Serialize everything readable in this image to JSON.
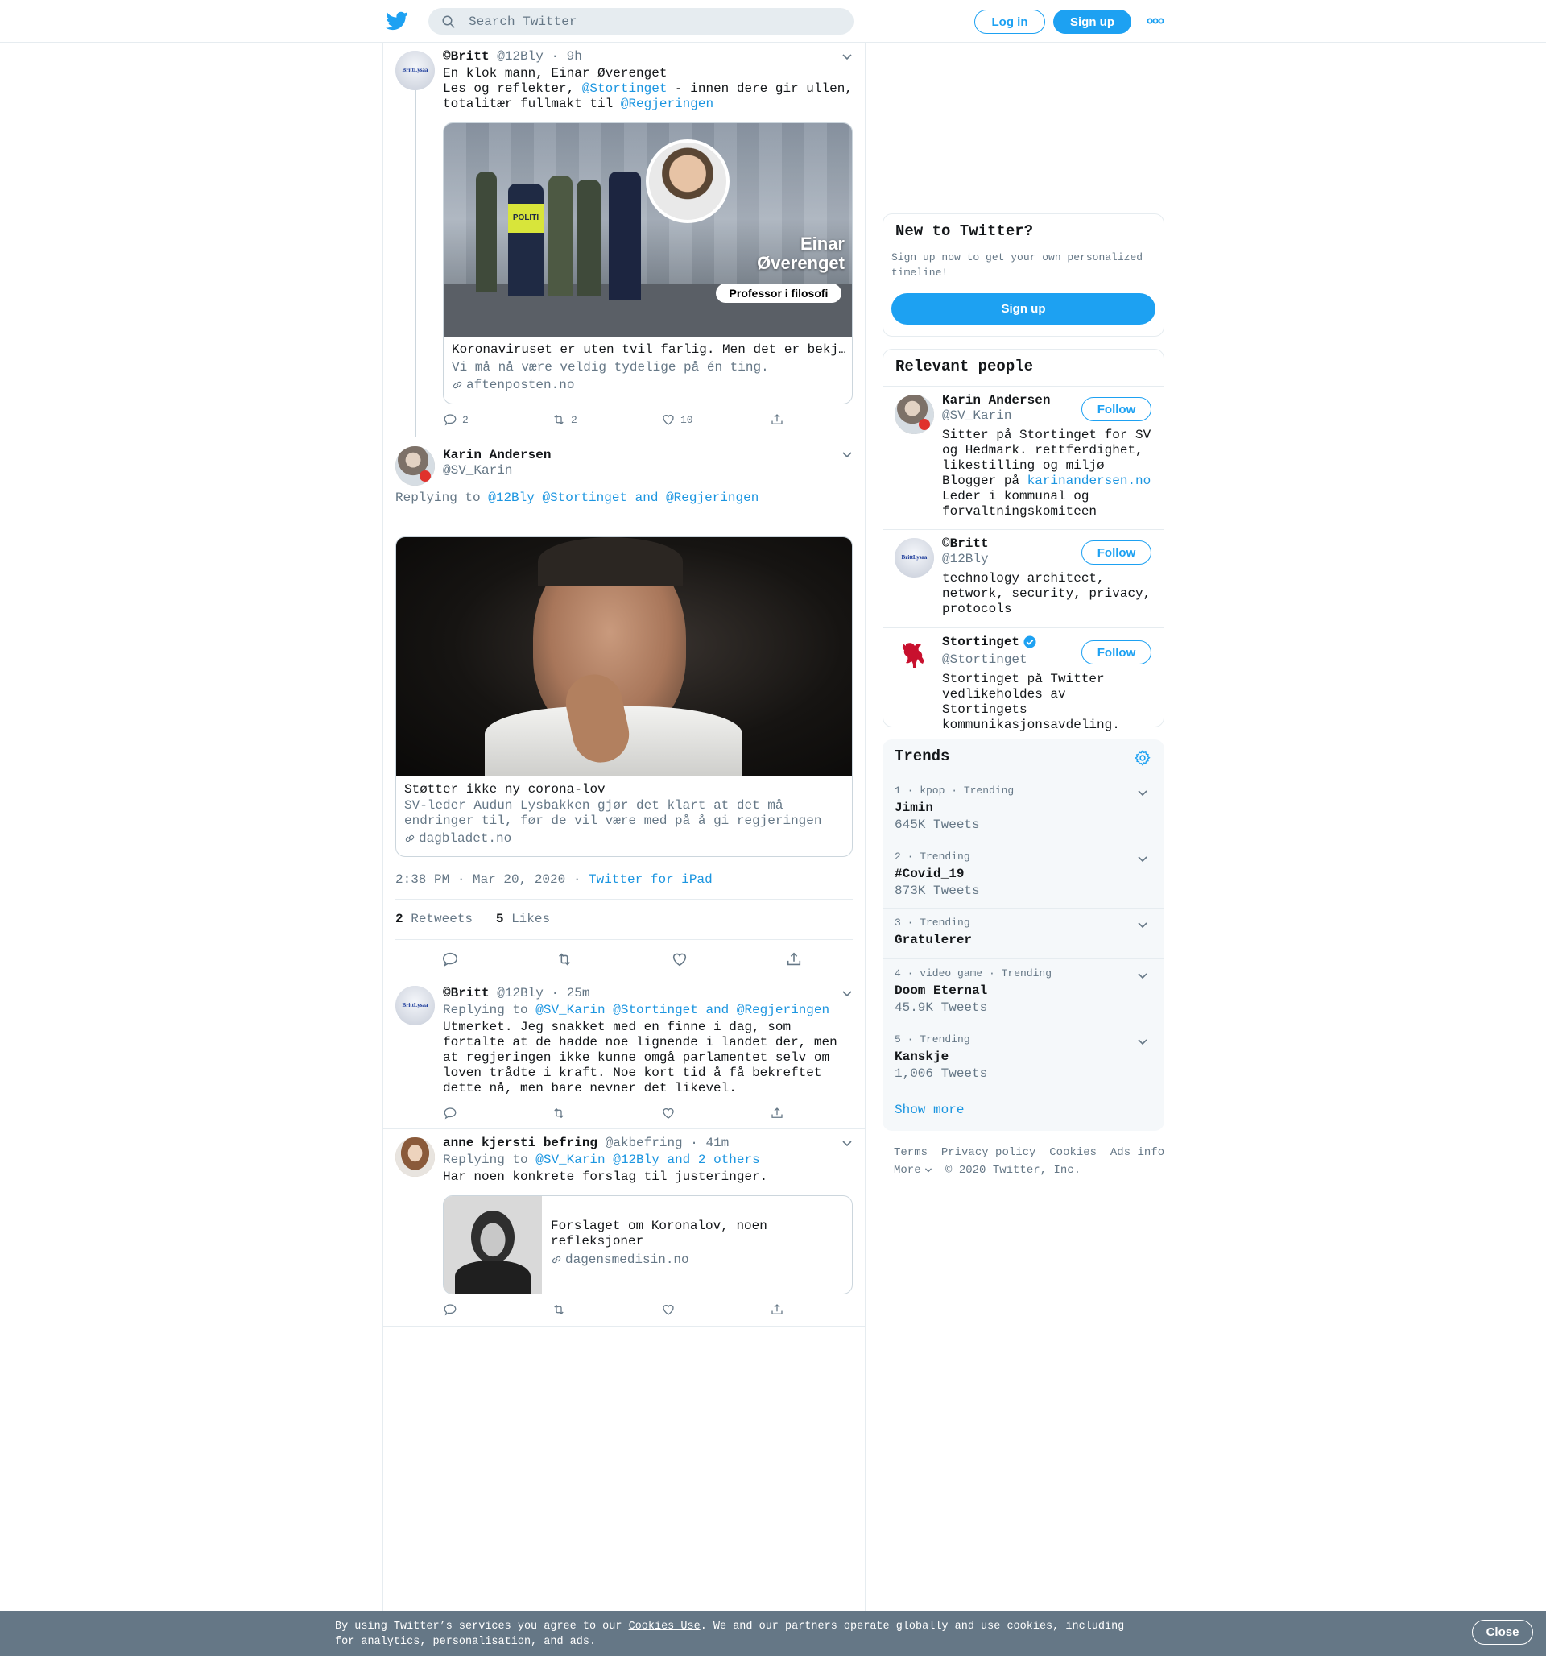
{
  "search": {
    "placeholder": "Search Twitter"
  },
  "nav": {
    "login": "Log in",
    "signup": "Sign up"
  },
  "thread": {
    "tweet1": {
      "name": "©Britt",
      "handle": "@12Bly",
      "time": "9h",
      "line1": "En klok mann, Einar Øverenget",
      "line2_pre": "Les og reflekter, ",
      "line2_link": "@Stortinget",
      "line2_post": " - innen dere gir ullen,",
      "line3_pre": "totalitær fullmakt til ",
      "line3_link": "@Regjeringen",
      "card": {
        "overlay_name_1": "Einar",
        "overlay_name_2": "Øverenget",
        "overlay_badge": "Professor i filosofi",
        "police_vest": "POLITI",
        "title": "Koronaviruset er uten tvil farlig. Men det er bekjemp…",
        "desc": "Vi må nå være veldig tydelige på én ting.",
        "url": "aftenposten.no"
      },
      "replies": "2",
      "retweets": "2",
      "likes": "10"
    },
    "main_tweet": {
      "name": "Karin Andersen",
      "handle": "@SV_Karin",
      "replying_label": "Replying to",
      "replying_to": "@12Bly @Stortinget and @Regjeringen",
      "card": {
        "title": "Støtter ikke ny corona-lov",
        "desc": "SV-leder Audun Lysbakken gjør det klart at det må endringer til, før de vil være med på å gi regjeringen mer makt i den…",
        "url": "dagbladet.no"
      },
      "timestamp": "2:38 PM · Mar 20, 2020",
      "source": "Twitter for iPad",
      "retweet_count": "2",
      "retweet_label": "Retweets",
      "like_count": "5",
      "like_label": "Likes"
    },
    "reply1": {
      "name": "©Britt",
      "handle": "@12Bly",
      "time": "25m",
      "replying_label": "Replying to",
      "replying_to": "@SV_Karin @Stortinget and @Regjeringen",
      "text": "Utmerket. Jeg snakket med en finne i dag, som fortalte at de hadde noe lignende i landet der, men at regjeringen ikke kunne omgå parlamentet selv om loven trådte i kraft. Noe kort tid å få bekreftet dette nå, men bare nevner det likevel."
    },
    "reply2": {
      "name": "anne kjersti befring",
      "handle": "@akbefring",
      "time": "41m",
      "replying_label": "Replying to",
      "replying_to": "@SV_Karin @12Bly and 2 others",
      "text": "Har noen konkrete forslag til justeringer.",
      "card": {
        "title": "Forslaget om Koronalov, noen refleksjoner",
        "url": "dagensmedisin.no"
      }
    }
  },
  "sidebar": {
    "new_to_twitter": {
      "title": "New to Twitter?",
      "text": "Sign up now to get your own personalized timeline!",
      "button": "Sign up"
    },
    "relevant": {
      "title": "Relevant people",
      "people": [
        {
          "name": "Karin Andersen",
          "handle": "@SV_Karin",
          "bio_1": "Sitter på Stortinget for SV og Hedmark. rettferdighet, likestilling og miljø",
          "bio_link_pre": "Blogger på ",
          "bio_link": "karinandersen.no",
          "bio_2": "Leder i kommunal og forvaltningskomiteen",
          "follow": "Follow"
        },
        {
          "name": "©Britt",
          "handle": "@12Bly",
          "bio_1": "technology architect, network, security, privacy, protocols",
          "follow": "Follow"
        },
        {
          "name": "Stortinget",
          "handle": "@Stortinget",
          "bio_1": "Stortinget på Twitter vedlikeholdes av Stortingets kommunikasjonsavdeling.",
          "follow": "Follow",
          "verified": true
        }
      ]
    },
    "trends": {
      "title": "Trends",
      "items": [
        {
          "meta": "1 · kpop · Trending",
          "name": "Jimin",
          "count": "645K Tweets"
        },
        {
          "meta": "2 · Trending",
          "name": "#Covid_19",
          "count": "873K Tweets"
        },
        {
          "meta": "3 · Trending",
          "name": "Gratulerer",
          "count": ""
        },
        {
          "meta": "4 · video game · Trending",
          "name": "Doom Eternal",
          "count": "45.9K Tweets"
        },
        {
          "meta": "5 · Trending",
          "name": "Kanskje",
          "count": "1,006 Tweets"
        }
      ],
      "show_more": "Show more"
    },
    "footer": {
      "links": [
        "Terms",
        "Privacy policy",
        "Cookies",
        "Ads info"
      ],
      "more": "More",
      "copyright": "© 2020 Twitter, Inc."
    }
  },
  "avatar_badge": "BrittLysaa",
  "cookie": {
    "text_pre": "By using Twitter’s services you agree to our ",
    "link": "Cookies Use",
    "text_post": ". We and our partners operate globally and use cookies, including for analytics, personalisation, and ads.",
    "close": "Close"
  },
  "colors": {
    "accent": "#1da1f2",
    "link": "#1b95e0",
    "secondary": "#657786",
    "cookie_bg": "#657786"
  }
}
